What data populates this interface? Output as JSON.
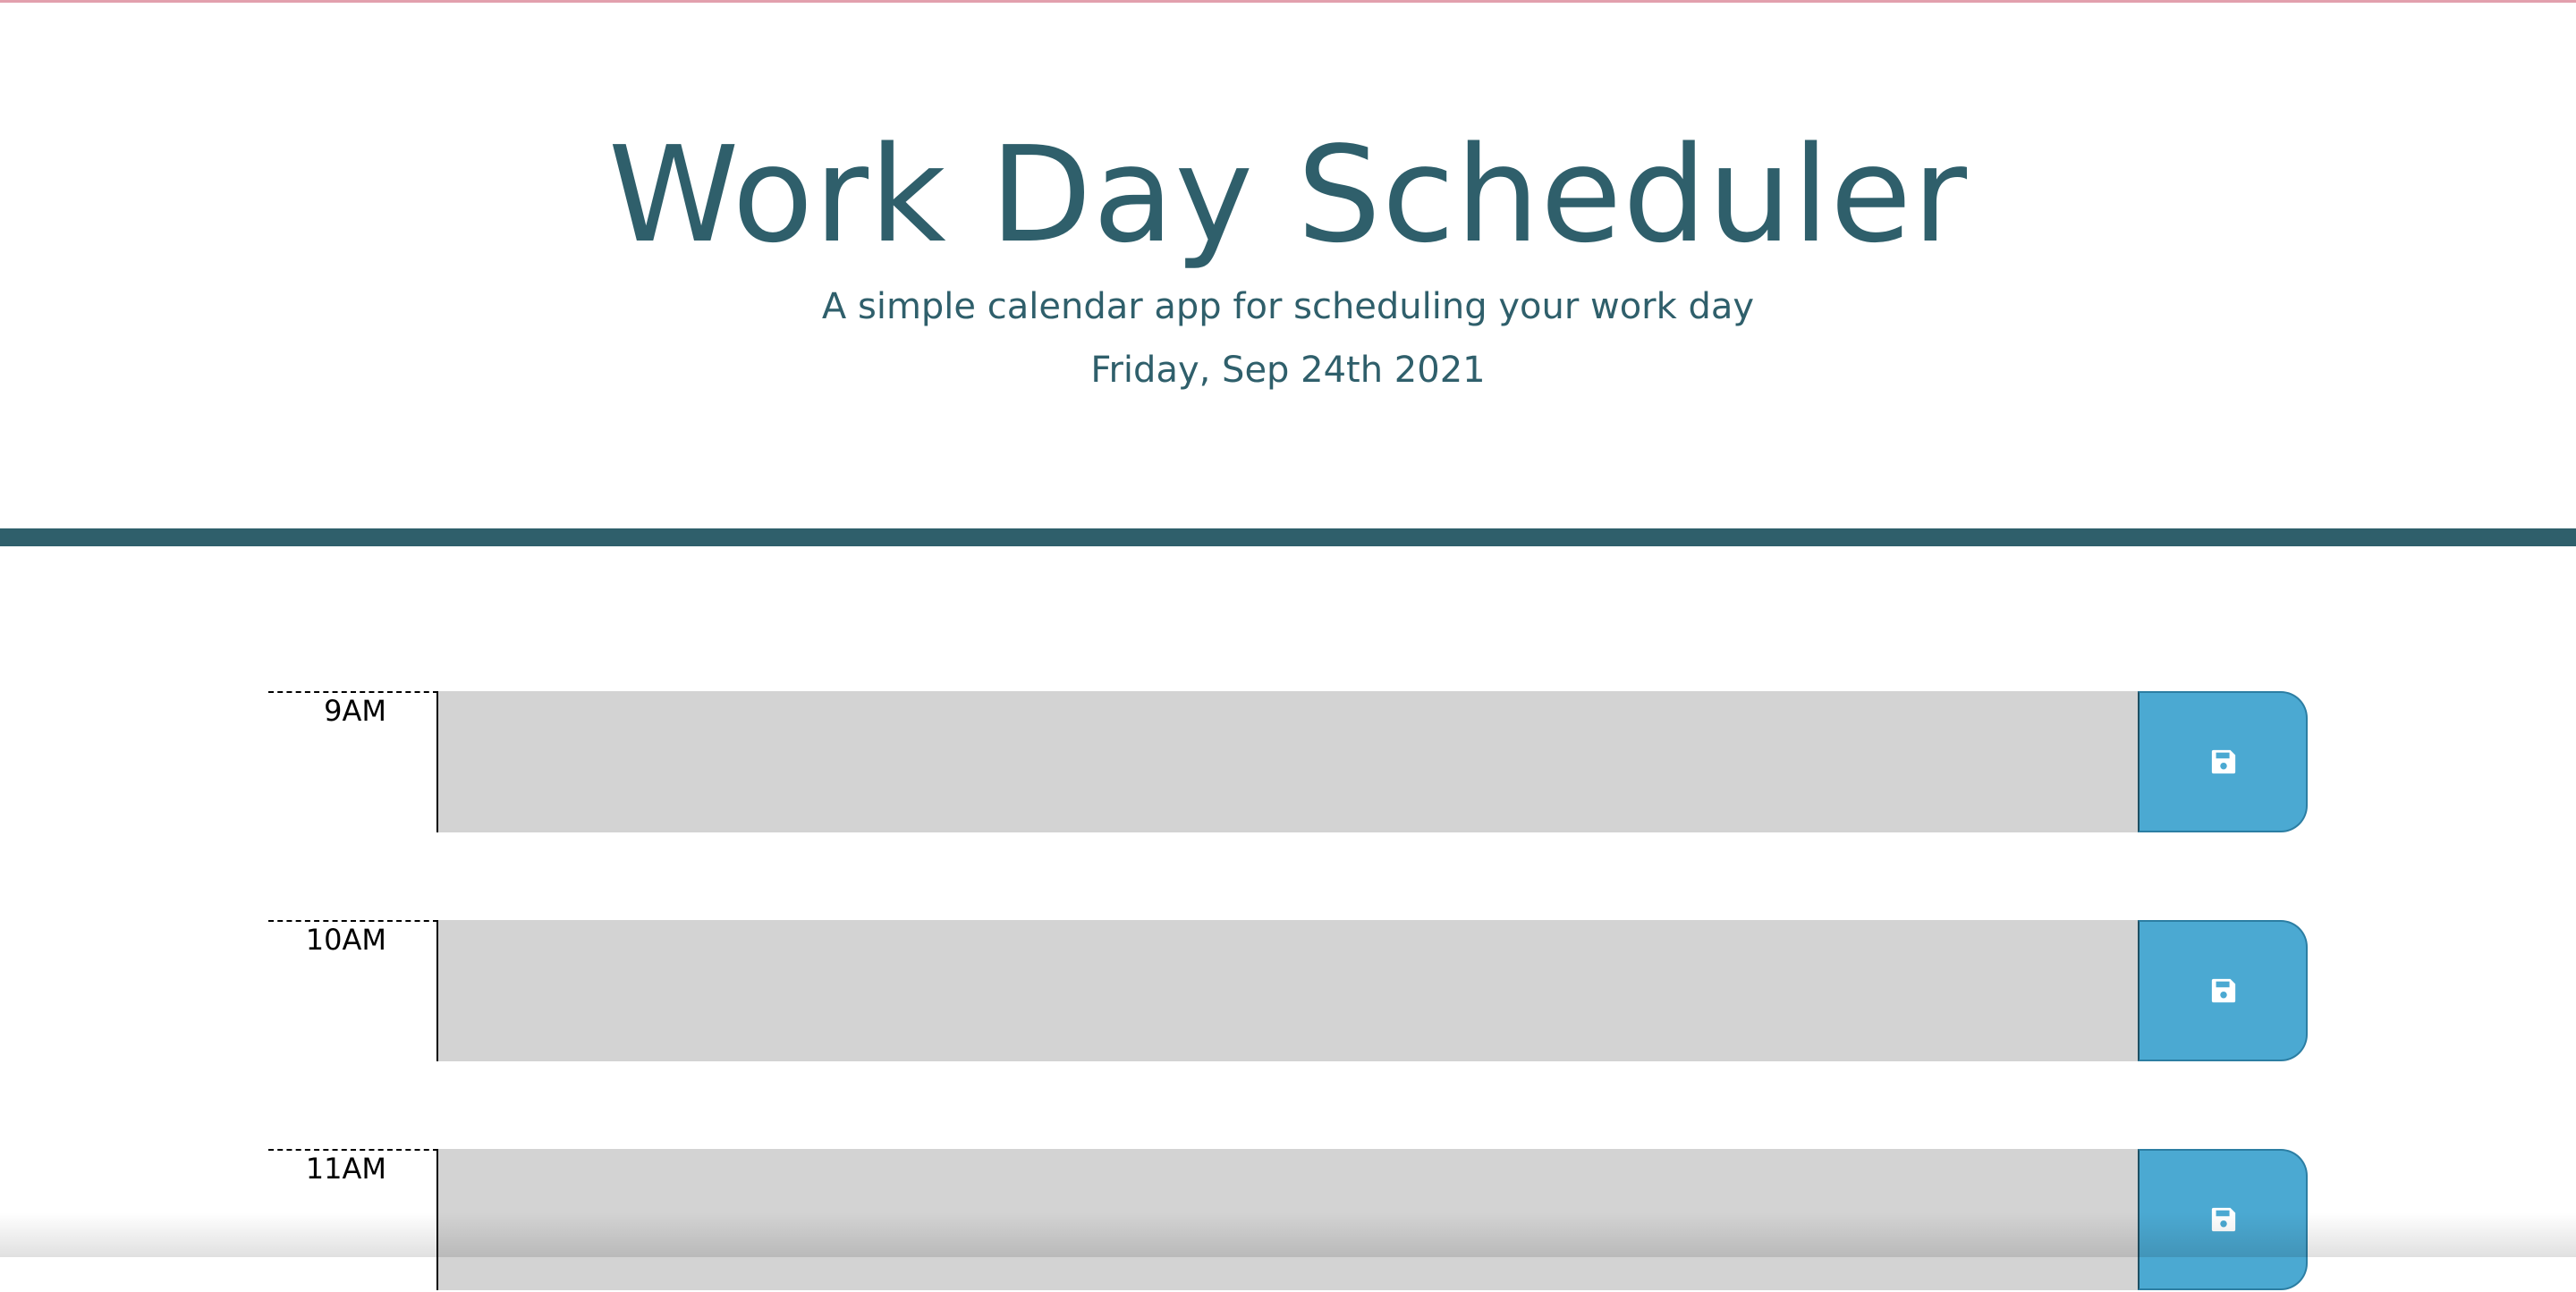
{
  "header": {
    "title": "Work Day Scheduler",
    "subtitle": "A simple calendar app for scheduling your work day",
    "current_date": "Friday, Sep 24th 2021"
  },
  "time_blocks": [
    {
      "hour": "9AM",
      "text": "",
      "save_icon": "save-icon"
    },
    {
      "hour": "10AM",
      "text": "",
      "save_icon": "save-icon"
    },
    {
      "hour": "11AM",
      "text": "",
      "save_icon": "save-icon"
    }
  ],
  "colors": {
    "primary": "#2f5f6b",
    "save_button": "#4ba9d2",
    "block_background": "#d3d3d3"
  }
}
